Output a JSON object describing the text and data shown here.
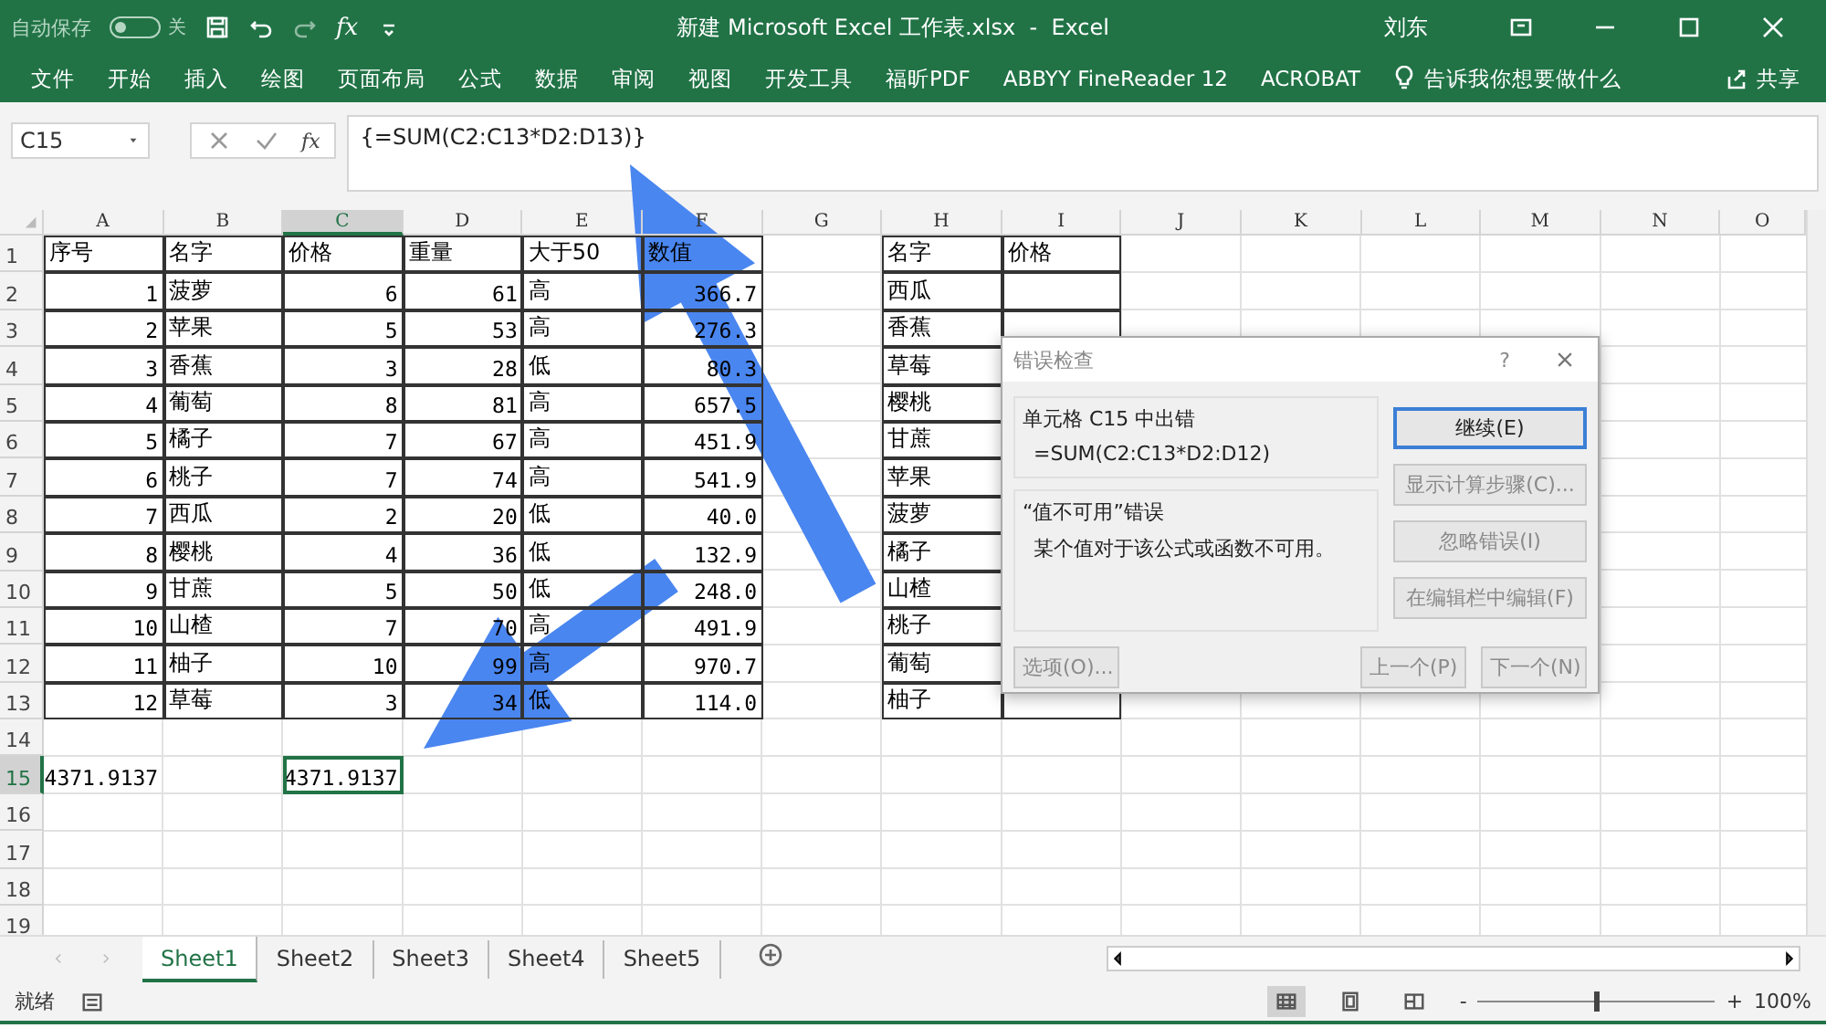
{
  "title_bar": {
    "autosave_label": "自动保存",
    "autosave_state": "关",
    "autosave_on": false,
    "function_glyph": "fx",
    "title": "新建 Microsoft Excel 工作表.xlsx  -  Excel",
    "user": "刘东"
  },
  "ribbon": {
    "tabs": [
      "文件",
      "开始",
      "插入",
      "绘图",
      "页面布局",
      "公式",
      "数据",
      "审阅",
      "视图",
      "开发工具",
      "福昕PDF",
      "ABBYY FineReader 12",
      "ACROBAT"
    ],
    "tell_me": "告诉我你想要做什么",
    "share": "共享"
  },
  "formula_bar": {
    "name_box": "C15",
    "function_glyph": "fx",
    "formula": "{=SUM(C2:C13*D2:D13)}"
  },
  "sheet": {
    "columns": [
      {
        "label": "A",
        "selected": false
      },
      {
        "label": "B",
        "selected": false
      },
      {
        "label": "C",
        "selected": true
      },
      {
        "label": "D",
        "selected": false
      },
      {
        "label": "E",
        "selected": false
      },
      {
        "label": "F",
        "selected": false
      },
      {
        "label": "G",
        "selected": false
      },
      {
        "label": "H",
        "selected": false
      },
      {
        "label": "I",
        "selected": false
      },
      {
        "label": "J",
        "selected": false
      },
      {
        "label": "K",
        "selected": false
      },
      {
        "label": "L",
        "selected": false
      },
      {
        "label": "M",
        "selected": false
      },
      {
        "label": "N",
        "selected": false
      },
      {
        "label": "O",
        "selected": false
      }
    ],
    "rows": [
      {
        "number": "1",
        "selected": false
      },
      {
        "number": "2",
        "selected": false
      },
      {
        "number": "3",
        "selected": false
      },
      {
        "number": "4",
        "selected": false
      },
      {
        "number": "5",
        "selected": false
      },
      {
        "number": "6",
        "selected": false
      },
      {
        "number": "7",
        "selected": false
      },
      {
        "number": "8",
        "selected": false
      },
      {
        "number": "9",
        "selected": false
      },
      {
        "number": "10",
        "selected": false
      },
      {
        "number": "11",
        "selected": false
      },
      {
        "number": "12",
        "selected": false
      },
      {
        "number": "13",
        "selected": false
      },
      {
        "number": "14",
        "selected": false
      },
      {
        "number": "15",
        "selected": true
      },
      {
        "number": "16",
        "selected": false
      },
      {
        "number": "17",
        "selected": false
      },
      {
        "number": "18",
        "selected": false
      },
      {
        "number": "19",
        "selected": false
      }
    ],
    "tables": [
      {
        "columns": [
          {
            "header": "序号",
            "kind": "number"
          },
          {
            "header": "名字",
            "kind": "text"
          },
          {
            "header": "价格",
            "kind": "number"
          },
          {
            "header": "重量",
            "kind": "number"
          },
          {
            "header": "大于50",
            "kind": "text"
          },
          {
            "header": "数值",
            "kind": "number"
          }
        ],
        "rows": [
          [
            "1",
            "菠萝",
            "6",
            "61",
            "高",
            "366.7"
          ],
          [
            "2",
            "苹果",
            "5",
            "53",
            "高",
            "276.3"
          ],
          [
            "3",
            "香蕉",
            "3",
            "28",
            "低",
            "80.3"
          ],
          [
            "4",
            "葡萄",
            "8",
            "81",
            "高",
            "657.5"
          ],
          [
            "5",
            "橘子",
            "7",
            "67",
            "高",
            "451.9"
          ],
          [
            "6",
            "桃子",
            "7",
            "74",
            "高",
            "541.9"
          ],
          [
            "7",
            "西瓜",
            "2",
            "20",
            "低",
            "40.0"
          ],
          [
            "8",
            "樱桃",
            "4",
            "36",
            "低",
            "132.9"
          ],
          [
            "9",
            "甘蔗",
            "5",
            "50",
            "低",
            "248.0"
          ],
          [
            "10",
            "山楂",
            "7",
            "70",
            "高",
            "491.9"
          ],
          [
            "11",
            "柚子",
            "10",
            "99",
            "高",
            "970.7"
          ],
          [
            "12",
            "草莓",
            "3",
            "34",
            "低",
            "114.0"
          ]
        ]
      },
      {
        "columns": [
          {
            "header": "名字",
            "kind": "text"
          },
          {
            "header": "价格",
            "kind": "text"
          }
        ],
        "rows": [
          [
            "西瓜"
          ],
          [
            "香蕉"
          ],
          [
            "草莓"
          ],
          [
            "樱桃"
          ],
          [
            "甘蔗"
          ],
          [
            "苹果"
          ],
          [
            "菠萝"
          ],
          [
            "橘子"
          ],
          [
            "山楂"
          ],
          [
            "桃子"
          ],
          [
            "葡萄"
          ],
          [
            "柚子"
          ]
        ]
      }
    ],
    "results": [
      {
        "value": "4371.9137",
        "selected": false
      },
      {
        "value": "4371.9137",
        "selected": true
      }
    ]
  },
  "dialog": {
    "title": "错误检查",
    "help": "?",
    "error_heading": "单元格 C15 中出错",
    "error_formula": "=SUM(C2:C13*D2:D12)",
    "error_type": "“值不可用”错误",
    "error_description": "某个值对于该公式或函数不可用。",
    "side_buttons": [
      {
        "label": "继续(E)",
        "disabled": false,
        "default": true
      },
      {
        "label": "显示计算步骤(C)...",
        "disabled": true,
        "default": false
      },
      {
        "label": "忽略错误(I)",
        "disabled": true,
        "default": false
      },
      {
        "label": "在编辑栏中编辑(F)",
        "disabled": true,
        "default": false
      }
    ],
    "options_button": {
      "label": "选项(O)...",
      "disabled": true
    },
    "nav_buttons": [
      {
        "label": "上一个(P)",
        "disabled": true
      },
      {
        "label": "下一个(N)",
        "disabled": true
      }
    ]
  },
  "sheet_tabs": [
    {
      "label": "Sheet1",
      "selected": true
    },
    {
      "label": "Sheet2",
      "selected": false
    },
    {
      "label": "Sheet3",
      "selected": false
    },
    {
      "label": "Sheet4",
      "selected": false
    },
    {
      "label": "Sheet5",
      "selected": false
    }
  ],
  "status_bar": {
    "status": "就绪",
    "zoom": {
      "level": 0.5,
      "minus": "-",
      "plus": "+",
      "reading": "100%"
    }
  }
}
